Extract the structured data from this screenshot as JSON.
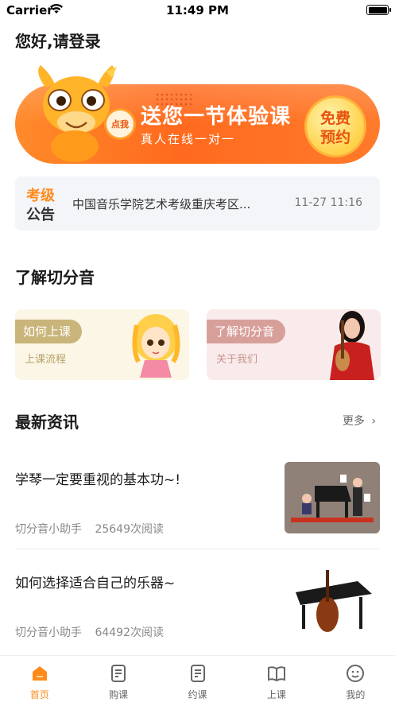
{
  "status_bar": {
    "carrier": "Carrier",
    "time": "11:49 PM"
  },
  "greeting": "您好,请登录",
  "banner": {
    "tap_badge": "点我",
    "title": "送您一节体验课",
    "subtitle": "真人在线一对一",
    "cta_line1": "免费",
    "cta_line2": "预约",
    "accent_color": "#ff6a1e"
  },
  "notice": {
    "tag_line1": "考级",
    "tag_line2": "公告",
    "text": "中国音乐学院艺术考级重庆考区...",
    "date": "11-27 11:16"
  },
  "about_section": {
    "title": "了解切分音",
    "cards": [
      {
        "label": "如何上课",
        "desc": "上课流程"
      },
      {
        "label": "了解切分音",
        "desc": "关于我们"
      }
    ]
  },
  "news_section": {
    "title": "最新资讯",
    "more": "更多",
    "items": [
      {
        "title": "学琴一定要重视的基本功~!",
        "author": "切分音小助手",
        "reads": "25649次阅读"
      },
      {
        "title": "如何选择适合自己的乐器~",
        "author": "切分音小助手",
        "reads": "64492次阅读"
      }
    ]
  },
  "tab_bar": {
    "active_color": "#ff8a1a",
    "tabs": [
      {
        "label": "首页",
        "icon": "home-icon"
      },
      {
        "label": "购课",
        "icon": "buy-course-icon"
      },
      {
        "label": "约课",
        "icon": "book-course-icon"
      },
      {
        "label": "上课",
        "icon": "open-book-icon"
      },
      {
        "label": "我的",
        "icon": "profile-icon"
      }
    ]
  }
}
